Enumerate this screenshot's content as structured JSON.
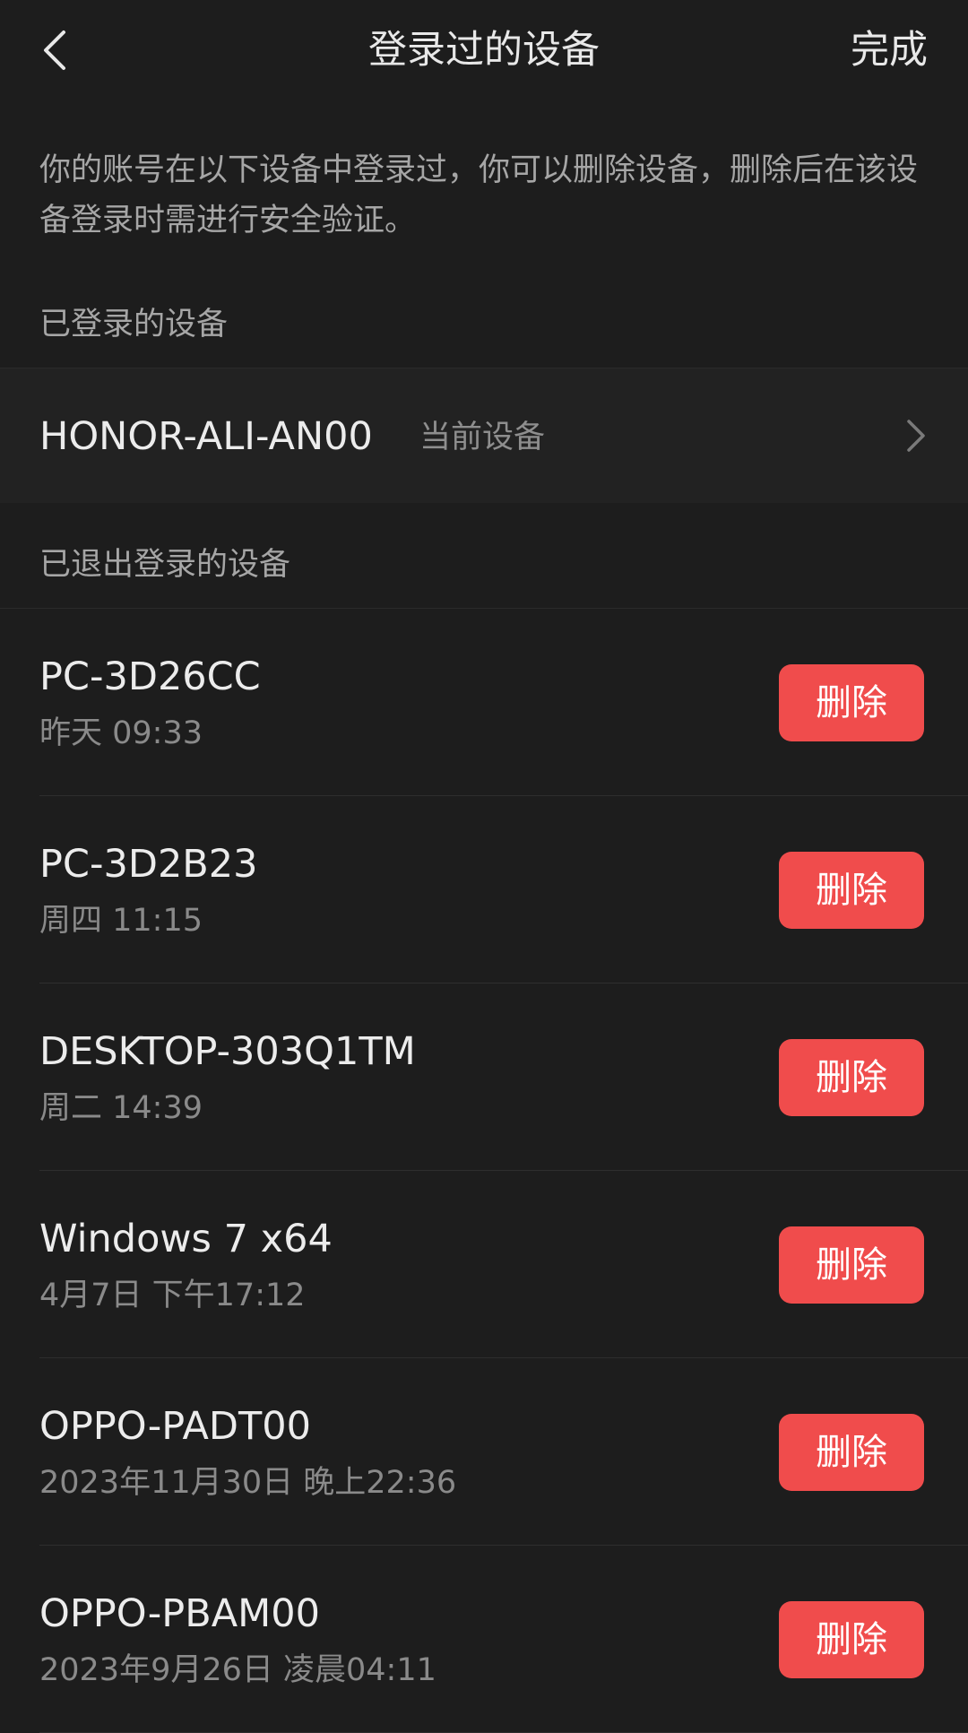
{
  "header": {
    "title": "登录过的设备",
    "done_label": "完成",
    "back_icon": "chevron-left-icon"
  },
  "description": "你的账号在以下设备中登录过，你可以删除设备，删除后在该设备登录时需进行安全验证。",
  "sections": {
    "logged_in_label": "已登录的设备",
    "logged_out_label": "已退出登录的设备"
  },
  "current_device": {
    "name": "HONOR-ALI-AN00",
    "badge": "当前设备",
    "icon": "chevron-right-icon"
  },
  "devices": [
    {
      "name": "PC-3D26CC",
      "time": "昨天 09:33",
      "delete_label": "删除"
    },
    {
      "name": "PC-3D2B23",
      "time": "周四 11:15",
      "delete_label": "删除"
    },
    {
      "name": "DESKTOP-303Q1TM",
      "time": "周二 14:39",
      "delete_label": "删除"
    },
    {
      "name": "Windows 7 x64",
      "time": "4月7日 下午17:12",
      "delete_label": "删除"
    },
    {
      "name": "OPPO-PADT00",
      "time": "2023年11月30日 晚上22:36",
      "delete_label": "删除"
    },
    {
      "name": "OPPO-PBAM00",
      "time": "2023年9月26日 凌晨04:11",
      "delete_label": "删除"
    }
  ],
  "colors": {
    "background": "#1d1d1d",
    "row_background": "#222222",
    "delete_button": "#f04c4c",
    "primary_text": "#ececec",
    "secondary_text": "#8a8a8a"
  }
}
